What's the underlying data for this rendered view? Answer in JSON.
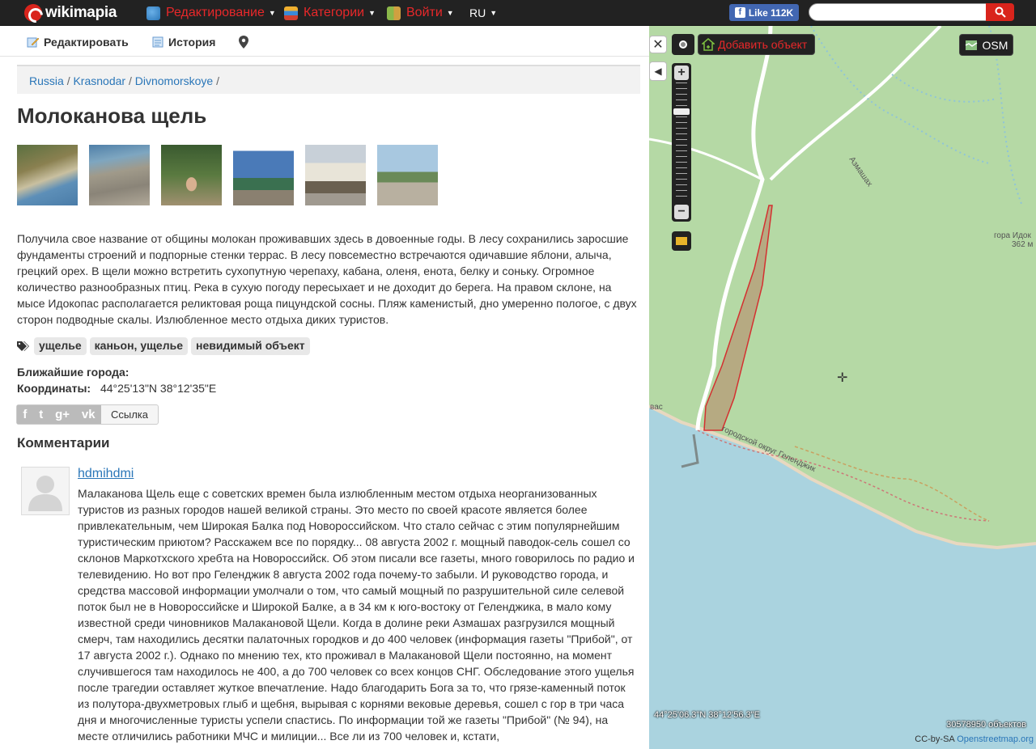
{
  "topbar": {
    "logo": "wikimapia",
    "nav_edit": "Редактирование",
    "nav_categories": "Категории",
    "nav_login": "Войти",
    "lang": "RU",
    "fb_like": "Like 112K"
  },
  "toolbar": {
    "edit": "Редактировать",
    "history": "История"
  },
  "breadcrumb": {
    "items": [
      "Russia",
      "Krasnodar",
      "Divnomorskoye"
    ],
    "separator": "/"
  },
  "place": {
    "title": "Молоканова щель",
    "description": "Получила свое название от общины молокан проживавших здесь в довоенные годы. В лесу сохранились заросшие фундаменты строений и подпорные стенки террас. В лесу повсеместно встречаются одичавшие яблони, алыча, грецкий орех. В щели можно встретить сухопутную черепаху, кабана, оленя, енота, белку и соньку. Огромное количество разнообразных птиц. Река в сухую погоду пересыхает и не доходит до берега. На правом склоне, на мысе Идокопас располагается реликтовая роща пицундской сосны. Пляж каменистый, дно умеренно пологое, с двух сторон подводные скалы. Излюбленное место отдыха диких туристов.",
    "tags": [
      "ущелье",
      "каньон, ущелье",
      "невидимый объект"
    ],
    "nearest_cities_label": "Ближайшие города:",
    "coords_label": "Координаты:",
    "coords_value": "44°25'13\"N 38°12'35\"E",
    "share_link": "Ссылка"
  },
  "comments": {
    "heading": "Комментарии",
    "items": [
      {
        "user": "hdmihdmi",
        "text": "Малаканова Щель еще с советских времен была излюбленным местом отдыха неорганизованных туристов из разных городов нашей великой страны. Это место по своей красоте является более привлекательным, чем Широкая Балка под Новороссийском. Что стало сейчас с этим популярнейшим туристическим приютом? Расскажем все по порядку... 08 августа 2002 г. мощный паводок-сель сошел со склонов Маркотхского хребта на Новороссийск. Об этом писали все газеты, много говорилось по радио и телевидению. Но вот про Геленджик 8 августа 2002 года почему-то забыли. И руководство города, и средства массовой информации умолчали о том, что самый мощный по разрушительной силе селевой поток был не в Новороссийске и Широкой Балке, а в 34 км к юго-востоку от Геленджика, в мало кому известной среди чиновников Малакановой Щели. Когда в долине реки Азмашах разгрузился мощный смерч, там находились десятки палаточных городков и до 400 человек (информация газеты \"Прибой\", от 17 августа 2002 г.). Однако по мнению тех, кто проживал в Малакановой Щели постоянно, на момент случившегося там находилось не 400, а до 700 человек со всех концов СНГ. Обследование этого ущелья после трагедии оставляет жуткое впечатление. Надо благодарить Бога за то, что грязе-каменный поток из полутора-двухметровых глыб и щебня, вырывая с корнями вековые деревья, сошел с гор в три часа дня и многочисленные туристы успели спастись. По информации той же газеты \"Прибой\" (№ 94), на месте отличились работники МЧС и милиции... Все ли из 700 человек и, кстати,"
      }
    ]
  },
  "map": {
    "add_object": "Добавить объект",
    "layer": "OSM",
    "cursor_coords": "44°25'06.3\"N 38°12'56.3\"E",
    "object_count": "30578950 объектов",
    "attribution_prefix": "CC-by-SA",
    "attribution_link": "Openstreetmap.org",
    "label_mountain": "гора Идок",
    "label_height": "362 м",
    "label_road": "Азмашах",
    "label_district": "городской округ Геленджик",
    "label_left": "вас"
  },
  "colors": {
    "brand_red": "#d9241c",
    "link_blue": "#2a76b8",
    "map_green": "#b5d9a5",
    "sea_blue": "#aad3df"
  }
}
